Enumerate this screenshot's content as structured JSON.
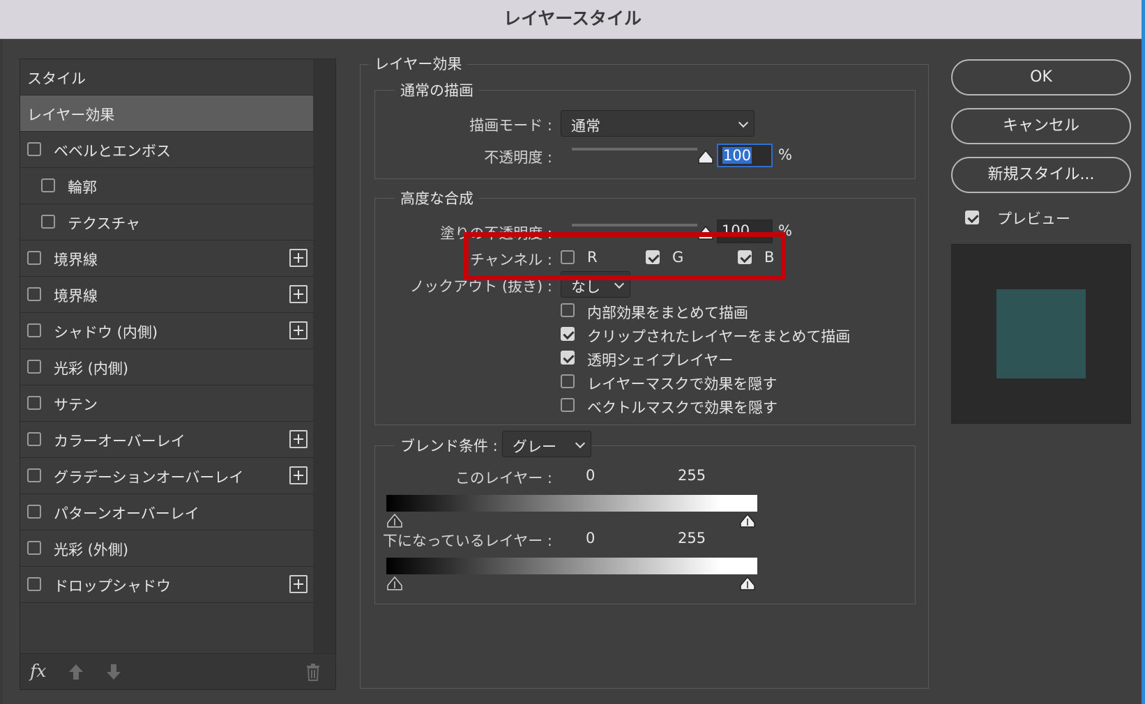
{
  "window": {
    "title": "レイヤースタイル"
  },
  "sidebar": {
    "items": [
      {
        "label": "スタイル",
        "kind": "header"
      },
      {
        "label": "レイヤー効果",
        "kind": "selected"
      },
      {
        "label": "ベベルとエンボス",
        "checked": false,
        "plus": false
      },
      {
        "label": "輪郭",
        "checked": false,
        "plus": false,
        "indent": true
      },
      {
        "label": "テクスチャ",
        "checked": false,
        "plus": false,
        "indent": true
      },
      {
        "label": "境界線",
        "checked": false,
        "plus": true
      },
      {
        "label": "境界線",
        "checked": false,
        "plus": true
      },
      {
        "label": "シャドウ (内側)",
        "checked": false,
        "plus": true
      },
      {
        "label": "光彩 (内側)",
        "checked": false,
        "plus": false
      },
      {
        "label": "サテン",
        "checked": false,
        "plus": false
      },
      {
        "label": "カラーオーバーレイ",
        "checked": false,
        "plus": true
      },
      {
        "label": "グラデーションオーバーレイ",
        "checked": false,
        "plus": true
      },
      {
        "label": "パターンオーバーレイ",
        "checked": false,
        "plus": false
      },
      {
        "label": "光彩 (外側)",
        "checked": false,
        "plus": false
      },
      {
        "label": "ドロップシャドウ",
        "checked": false,
        "plus": true
      }
    ],
    "footer": {
      "fx_label": "fx",
      "icons": [
        "fx-icon",
        "move-up-icon",
        "move-down-icon",
        "trash-icon"
      ]
    }
  },
  "main": {
    "panel_title": "レイヤー効果",
    "normal": {
      "title": "通常の描画",
      "blend_mode_label": "描画モード :",
      "blend_mode_value": "通常",
      "opacity_label": "不透明度 :",
      "opacity_value": "100",
      "opacity_fraction": 1.0,
      "percent": "%"
    },
    "advanced": {
      "title": "高度な合成",
      "fill_opacity_label": "塗りの不透明度 :",
      "fill_opacity_value": "100",
      "fill_opacity_fraction": 1.0,
      "percent": "%",
      "channels_label": "チャンネル :",
      "channels": [
        {
          "label": "R",
          "checked": false
        },
        {
          "label": "G",
          "checked": true
        },
        {
          "label": "B",
          "checked": true
        }
      ],
      "knockout_label": "ノックアウト (抜き) :",
      "knockout_value": "なし",
      "options": [
        {
          "label": "内部効果をまとめて描画",
          "checked": false
        },
        {
          "label": "クリップされたレイヤーをまとめて描画",
          "checked": true
        },
        {
          "label": "透明シェイプレイヤー",
          "checked": true
        },
        {
          "label": "レイヤーマスクで効果を隠す",
          "checked": false
        },
        {
          "label": "ベクトルマスクで効果を隠す",
          "checked": false
        }
      ]
    },
    "blend_if": {
      "label": "ブレンド条件 :",
      "value": "グレー",
      "this_layer": {
        "label": "このレイヤー :",
        "min": "0",
        "max": "255"
      },
      "underlying_layer": {
        "label": "下になっているレイヤー :",
        "min": "0",
        "max": "255"
      }
    }
  },
  "actions": {
    "ok_label": "OK",
    "cancel_label": "キャンセル",
    "new_style_label": "新規スタイル...",
    "preview_label": "プレビュー",
    "preview_checked": true
  },
  "colors": {
    "highlight": "#c6000b",
    "preview_swatch": "#2f5456",
    "selection": "#2e6fd0"
  }
}
